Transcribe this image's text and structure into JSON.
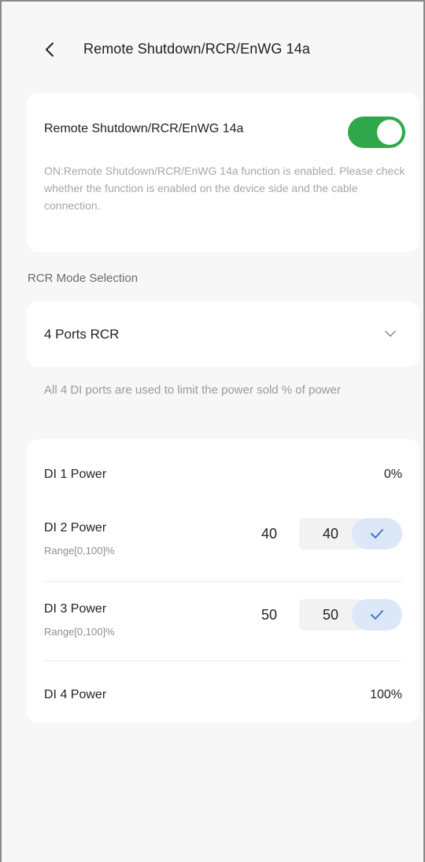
{
  "header": {
    "back_icon": "chevron-left-icon",
    "title": "Remote Shutdown/RCR/EnWG 14a"
  },
  "remote_card": {
    "label": "Remote Shutdown/RCR/EnWG 14a",
    "toggle_on": true,
    "toggle_color": "#2fa84a",
    "description": "ON:Remote Shutdown/RCR/EnWG 14a function is enabled. Please check whether the function is enabled on the device side and the cable connection."
  },
  "mode_section": {
    "label": "RCR Mode Selection",
    "selected": "4 Ports RCR",
    "dropdown_icon": "chevron-down-icon",
    "hint": "All 4 DI ports are used to limit the power sold % of power"
  },
  "ports": [
    {
      "name": "DI 1 Power",
      "value": "0%"
    },
    {
      "name": "DI 2 Power",
      "range": "Range[0,100]%",
      "current": "40",
      "input_value": "40",
      "confirm_icon": "check-icon"
    },
    {
      "name": "DI 3 Power",
      "range": "Range[0,100]%",
      "current": "50",
      "input_value": "50",
      "confirm_icon": "check-icon"
    },
    {
      "name": "DI 4 Power",
      "value": "100%"
    }
  ],
  "colors": {
    "accent_green": "#2fa84a",
    "confirm_bg": "#dce8f7",
    "confirm_check": "#3c78c8"
  }
}
